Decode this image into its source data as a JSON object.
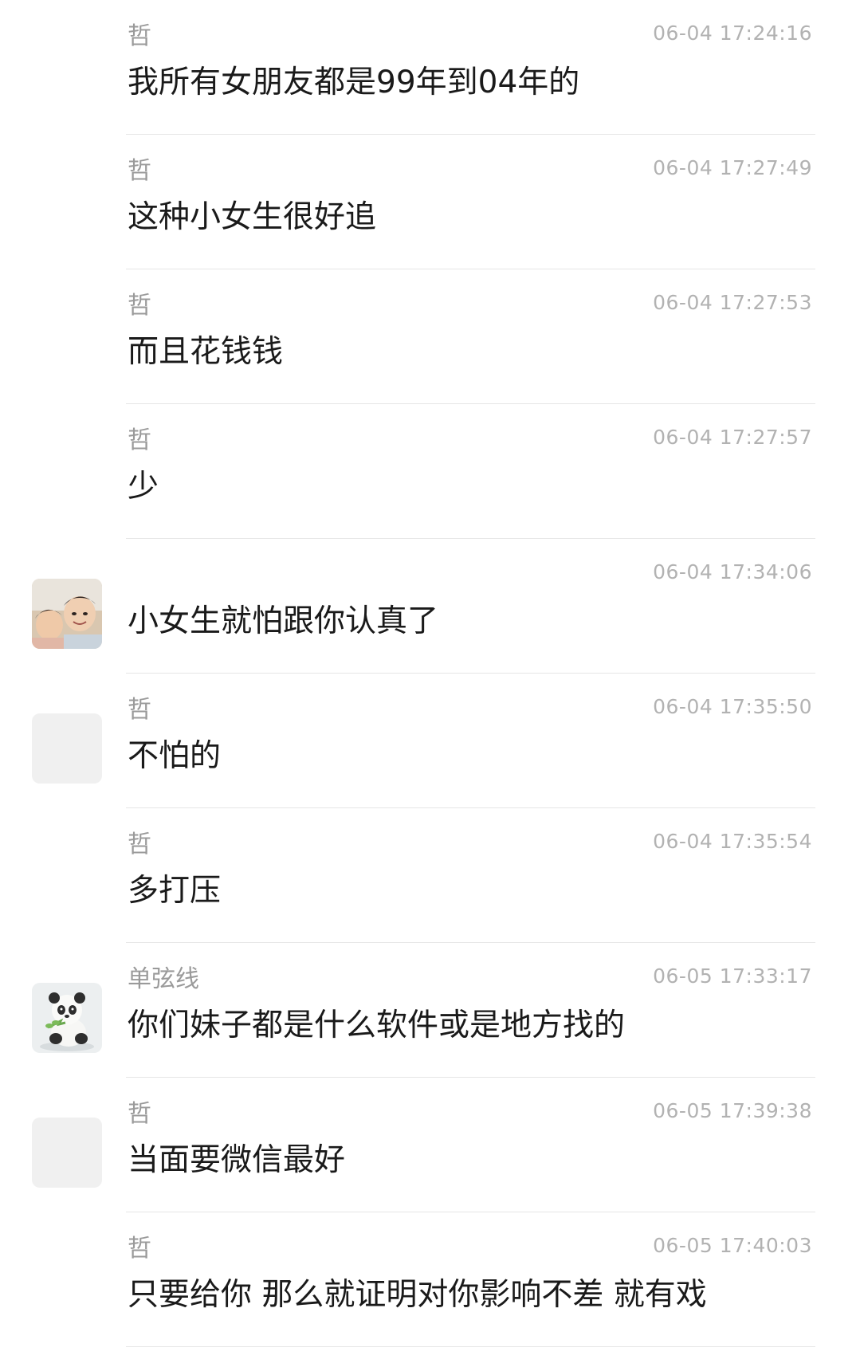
{
  "messages": [
    {
      "name": "哲",
      "time": "06-04 17:24:16",
      "text": "我所有女朋友都是99年到04年的",
      "avatar": "none"
    },
    {
      "name": "哲",
      "time": "06-04 17:27:49",
      "text": "这种小女生很好追",
      "avatar": "none"
    },
    {
      "name": "哲",
      "time": "06-04 17:27:53",
      "text": "而且花钱钱",
      "avatar": "none"
    },
    {
      "name": "哲",
      "time": "06-04 17:27:57",
      "text": "少",
      "avatar": "none"
    },
    {
      "name": "",
      "time": "06-04 17:34:06",
      "text": "小女生就怕跟你认真了",
      "avatar": "children-photo-avatar"
    },
    {
      "name": "哲",
      "time": "06-04 17:35:50",
      "text": "不怕的",
      "avatar": "blank-avatar"
    },
    {
      "name": "哲",
      "time": "06-04 17:35:54",
      "text": "多打压",
      "avatar": "none"
    },
    {
      "name": "单弦线",
      "time": "06-05 17:33:17",
      "text": "你们妹子都是什么软件或是地方找的",
      "avatar": "panda-avatar"
    },
    {
      "name": "哲",
      "time": "06-05 17:39:38",
      "text": "当面要微信最好",
      "avatar": "blank-avatar"
    },
    {
      "name": "哲",
      "time": "06-05 17:40:03",
      "text": "只要给你 那么就证明对你影响不差 就有戏",
      "avatar": "none"
    }
  ]
}
